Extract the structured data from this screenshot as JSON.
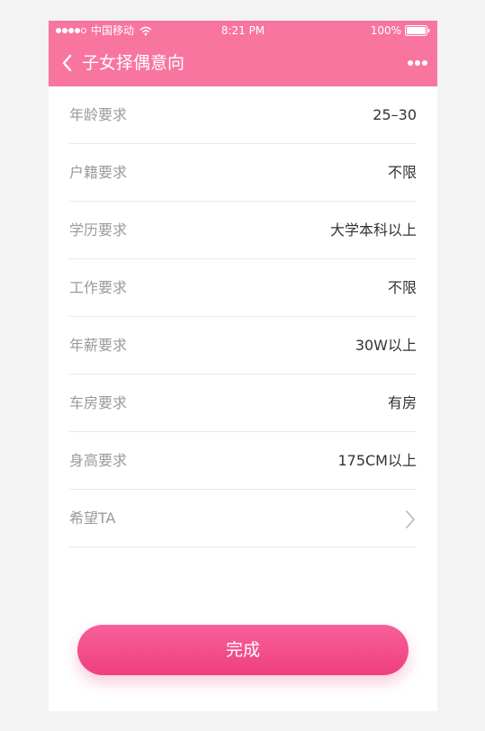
{
  "status_bar": {
    "carrier": "中国移动",
    "time": "8:21 PM",
    "battery": "100%"
  },
  "nav": {
    "title": "子女择偶意向",
    "back_icon": "chevron-left-icon",
    "more_icon": "more-dots-icon"
  },
  "requirements": [
    {
      "label": "年龄要求",
      "value": "25–30"
    },
    {
      "label": "户籍要求",
      "value": "不限"
    },
    {
      "label": "学历要求",
      "value": "大学本科以上"
    },
    {
      "label": "工作要求",
      "value": "不限"
    },
    {
      "label": "年薪要求",
      "value": "30W以上"
    },
    {
      "label": "车房要求",
      "value": "有房"
    },
    {
      "label": "身高要求",
      "value": "175CM以上"
    },
    {
      "label": "希望TA",
      "value": ""
    }
  ],
  "done_button": {
    "label": "完成"
  },
  "colors": {
    "header": "#f8759f",
    "button_top": "#f7609a",
    "button_bottom": "#ef3f7d"
  }
}
